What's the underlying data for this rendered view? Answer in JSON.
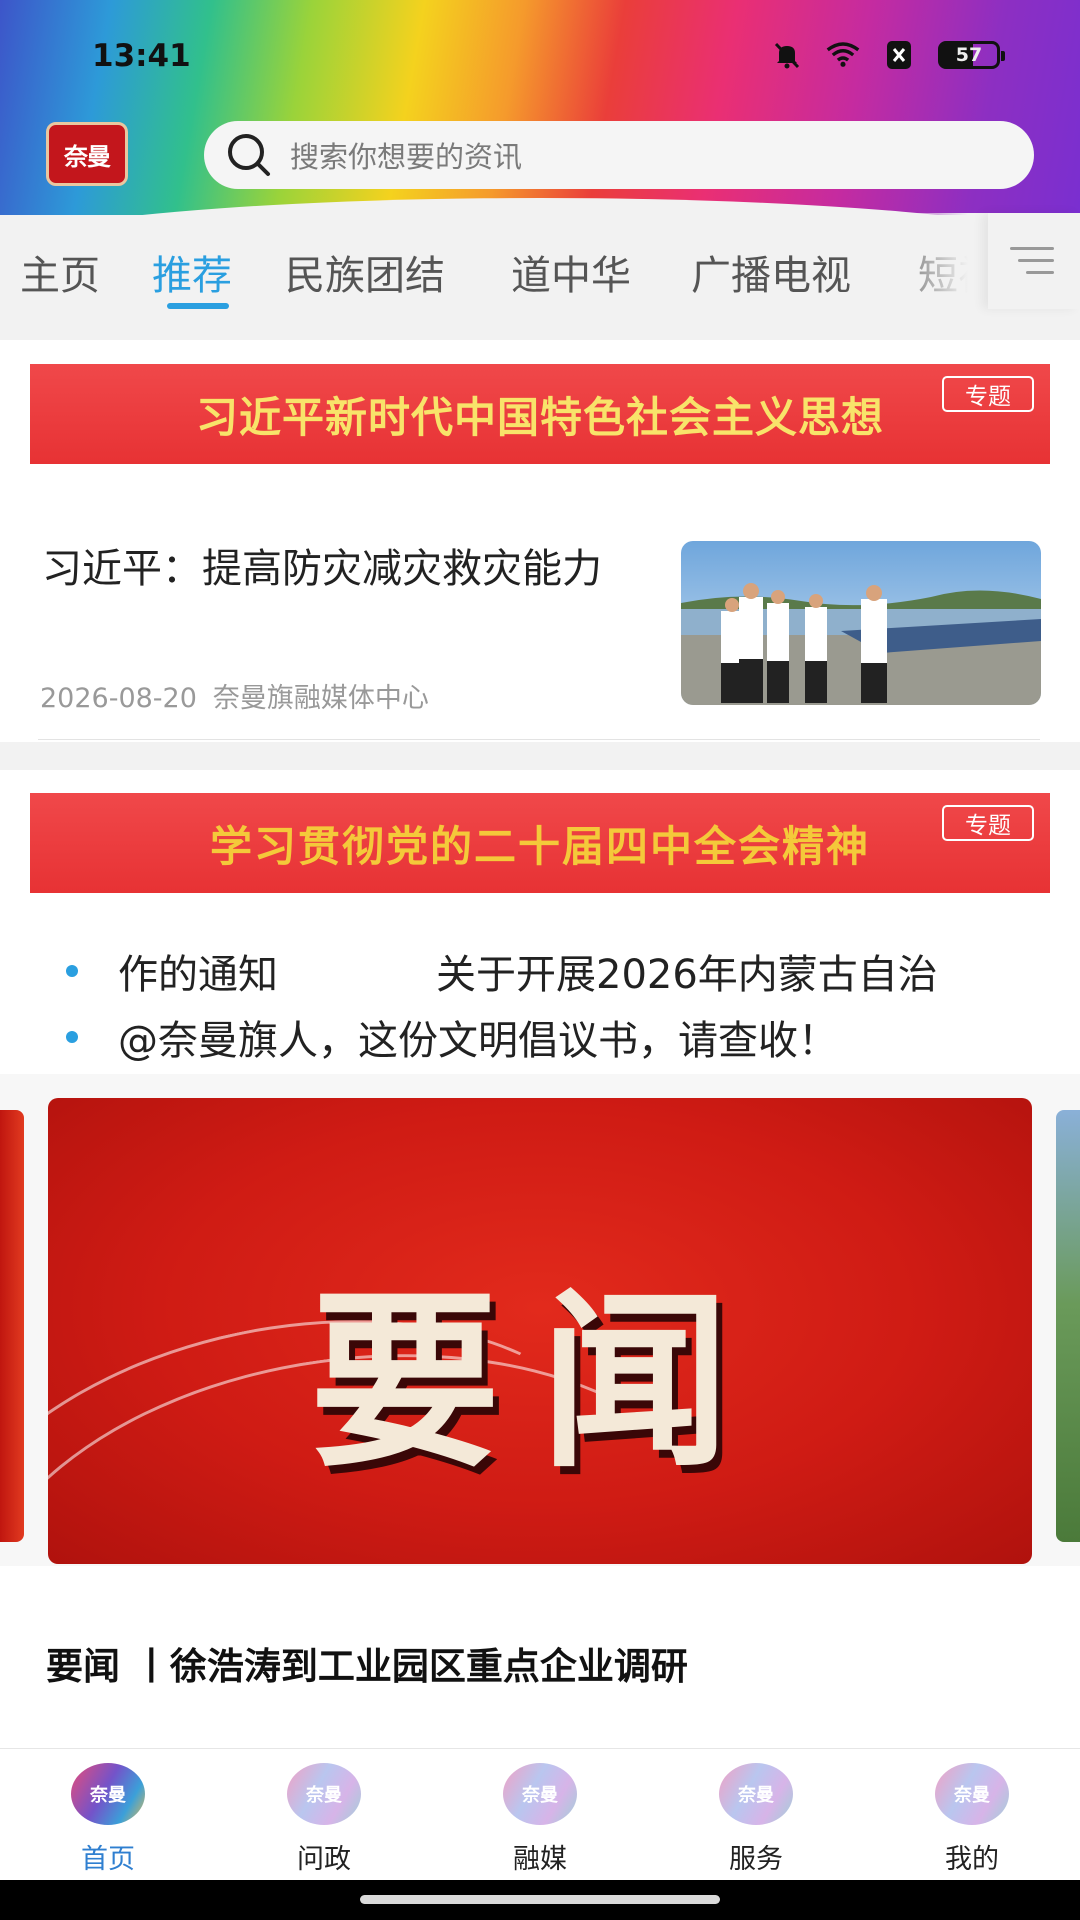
{
  "status": {
    "time": "13:41",
    "battery": "57",
    "icons": [
      "bell-muted-icon",
      "wifi-icon",
      "sim-off-icon",
      "battery-icon"
    ]
  },
  "header": {
    "logo_text": "奈曼",
    "search_placeholder": "搜索你想要的资讯",
    "search_icon": "search-icon"
  },
  "tabs": [
    {
      "label": "主页",
      "active": false
    },
    {
      "label": "推荐",
      "active": true
    },
    {
      "label": "民族团结",
      "active": false
    },
    {
      "label": "道中华",
      "active": false
    },
    {
      "label": "广播电视",
      "active": false
    },
    {
      "label": "短视",
      "active": false
    }
  ],
  "menu_icon": "menu-lines-icon",
  "banners": [
    {
      "text": "习近平新时代中国特色社会主义思想",
      "badge": "专题"
    },
    {
      "text": "学习贯彻党的二十届四中全会精神",
      "badge": "专题"
    }
  ],
  "news": {
    "title": "习近平：提高防灾减灾救灾能力",
    "date": "2026-08-20",
    "source": "奈曼旗融媒体中心"
  },
  "bullet_list": [
    {
      "text": "作的通知",
      "text_b": "关于开展2026年内蒙古自治"
    },
    {
      "text": "@奈曼旗人，这份文明倡议书，请查收！"
    }
  ],
  "carousel": {
    "slide_text": "要闻",
    "caption": "要闻 丨徐浩涛到工业园区重点企业调研"
  },
  "bottom_nav": [
    {
      "label": "首页",
      "icon_text": "奈曼",
      "active": true
    },
    {
      "label": "问政",
      "icon_text": "奈曼",
      "active": false
    },
    {
      "label": "融媒",
      "icon_text": "奈曼",
      "active": false
    },
    {
      "label": "服务",
      "icon_text": "奈曼",
      "active": false
    },
    {
      "label": "我的",
      "icon_text": "奈曼",
      "active": false
    }
  ],
  "colors": {
    "accent": "#2a9fe0",
    "banner_red": "#e73234",
    "banner_text": "#f8e36a"
  }
}
